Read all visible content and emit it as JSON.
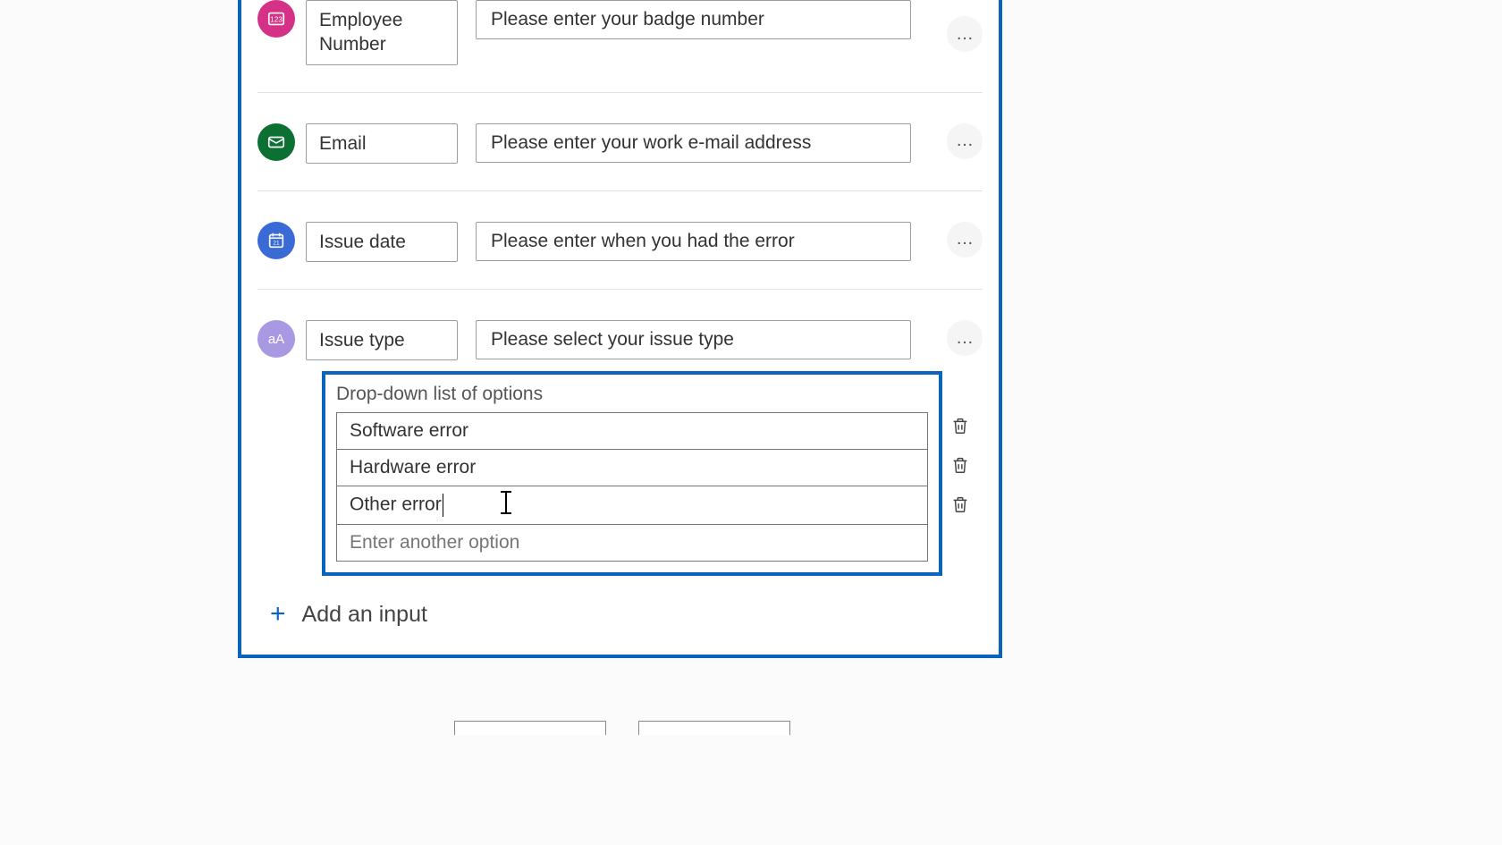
{
  "inputs": [
    {
      "name": "Employee Number",
      "prompt": "Please enter your badge number",
      "icon": "number-icon",
      "color": "pink"
    },
    {
      "name": "Email",
      "prompt": "Please enter your work e-mail address",
      "icon": "email-icon",
      "color": "green"
    },
    {
      "name": "Issue date",
      "prompt": "Please enter when you had the error",
      "icon": "calendar-icon",
      "color": "blue"
    },
    {
      "name": "Issue type",
      "prompt": "Please select your issue type",
      "icon": "text-icon",
      "color": "lilac"
    }
  ],
  "dropdown": {
    "title": "Drop-down list of options",
    "options": [
      "Software error",
      "Hardware error",
      "Other error"
    ],
    "new_option_placeholder": "Enter another option",
    "editing_index": 2
  },
  "add_input_label": "Add an input",
  "icon_text": {
    "text-icon": "aA"
  }
}
